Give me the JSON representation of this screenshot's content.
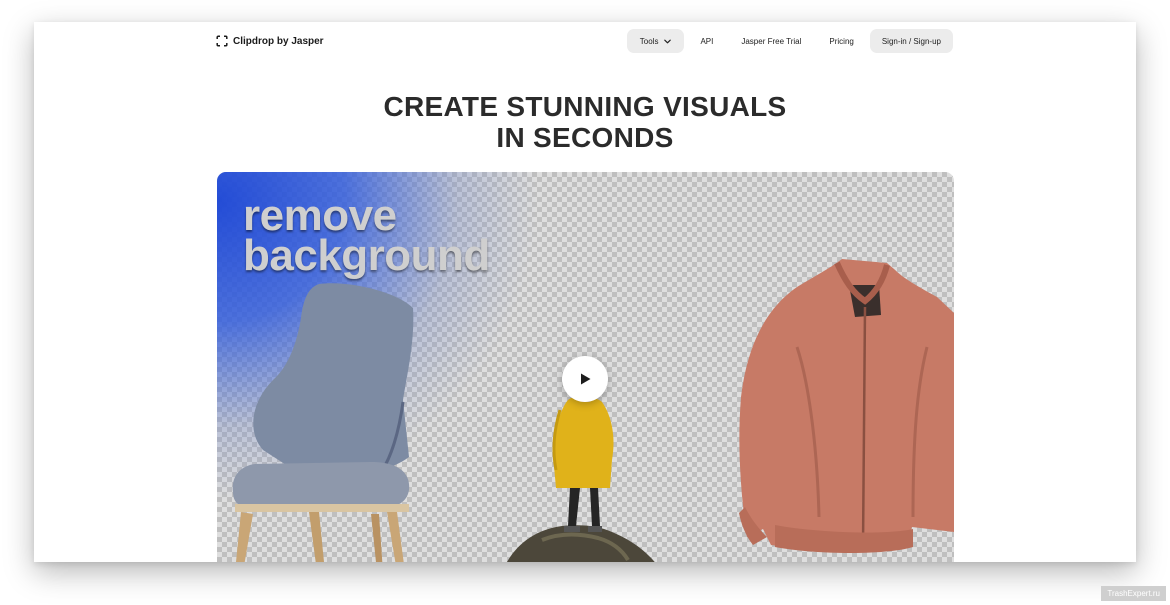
{
  "brand": {
    "name": "Clipdrop by Jasper",
    "logo_icon": "clipdrop-logo-icon"
  },
  "nav": {
    "tools_label": "Tools",
    "api_label": "API",
    "trial_label": "Jasper Free Trial",
    "pricing_label": "Pricing",
    "signin_label": "Sign-in / Sign-up"
  },
  "hero": {
    "headline_line1": "CREATE STUNNING VISUALS",
    "headline_line2": "IN SECONDS",
    "video_text_line1": "remove",
    "video_text_line2": "background",
    "play_icon": "play-icon"
  },
  "watermark": "TrashExpert.ru",
  "colors": {
    "accent_blue": "#1e48d6",
    "pill_bg": "#ececec",
    "headline": "#2b2b2b",
    "raincoat_yellow": "#e0b21a",
    "jacket": "#c77a66"
  }
}
